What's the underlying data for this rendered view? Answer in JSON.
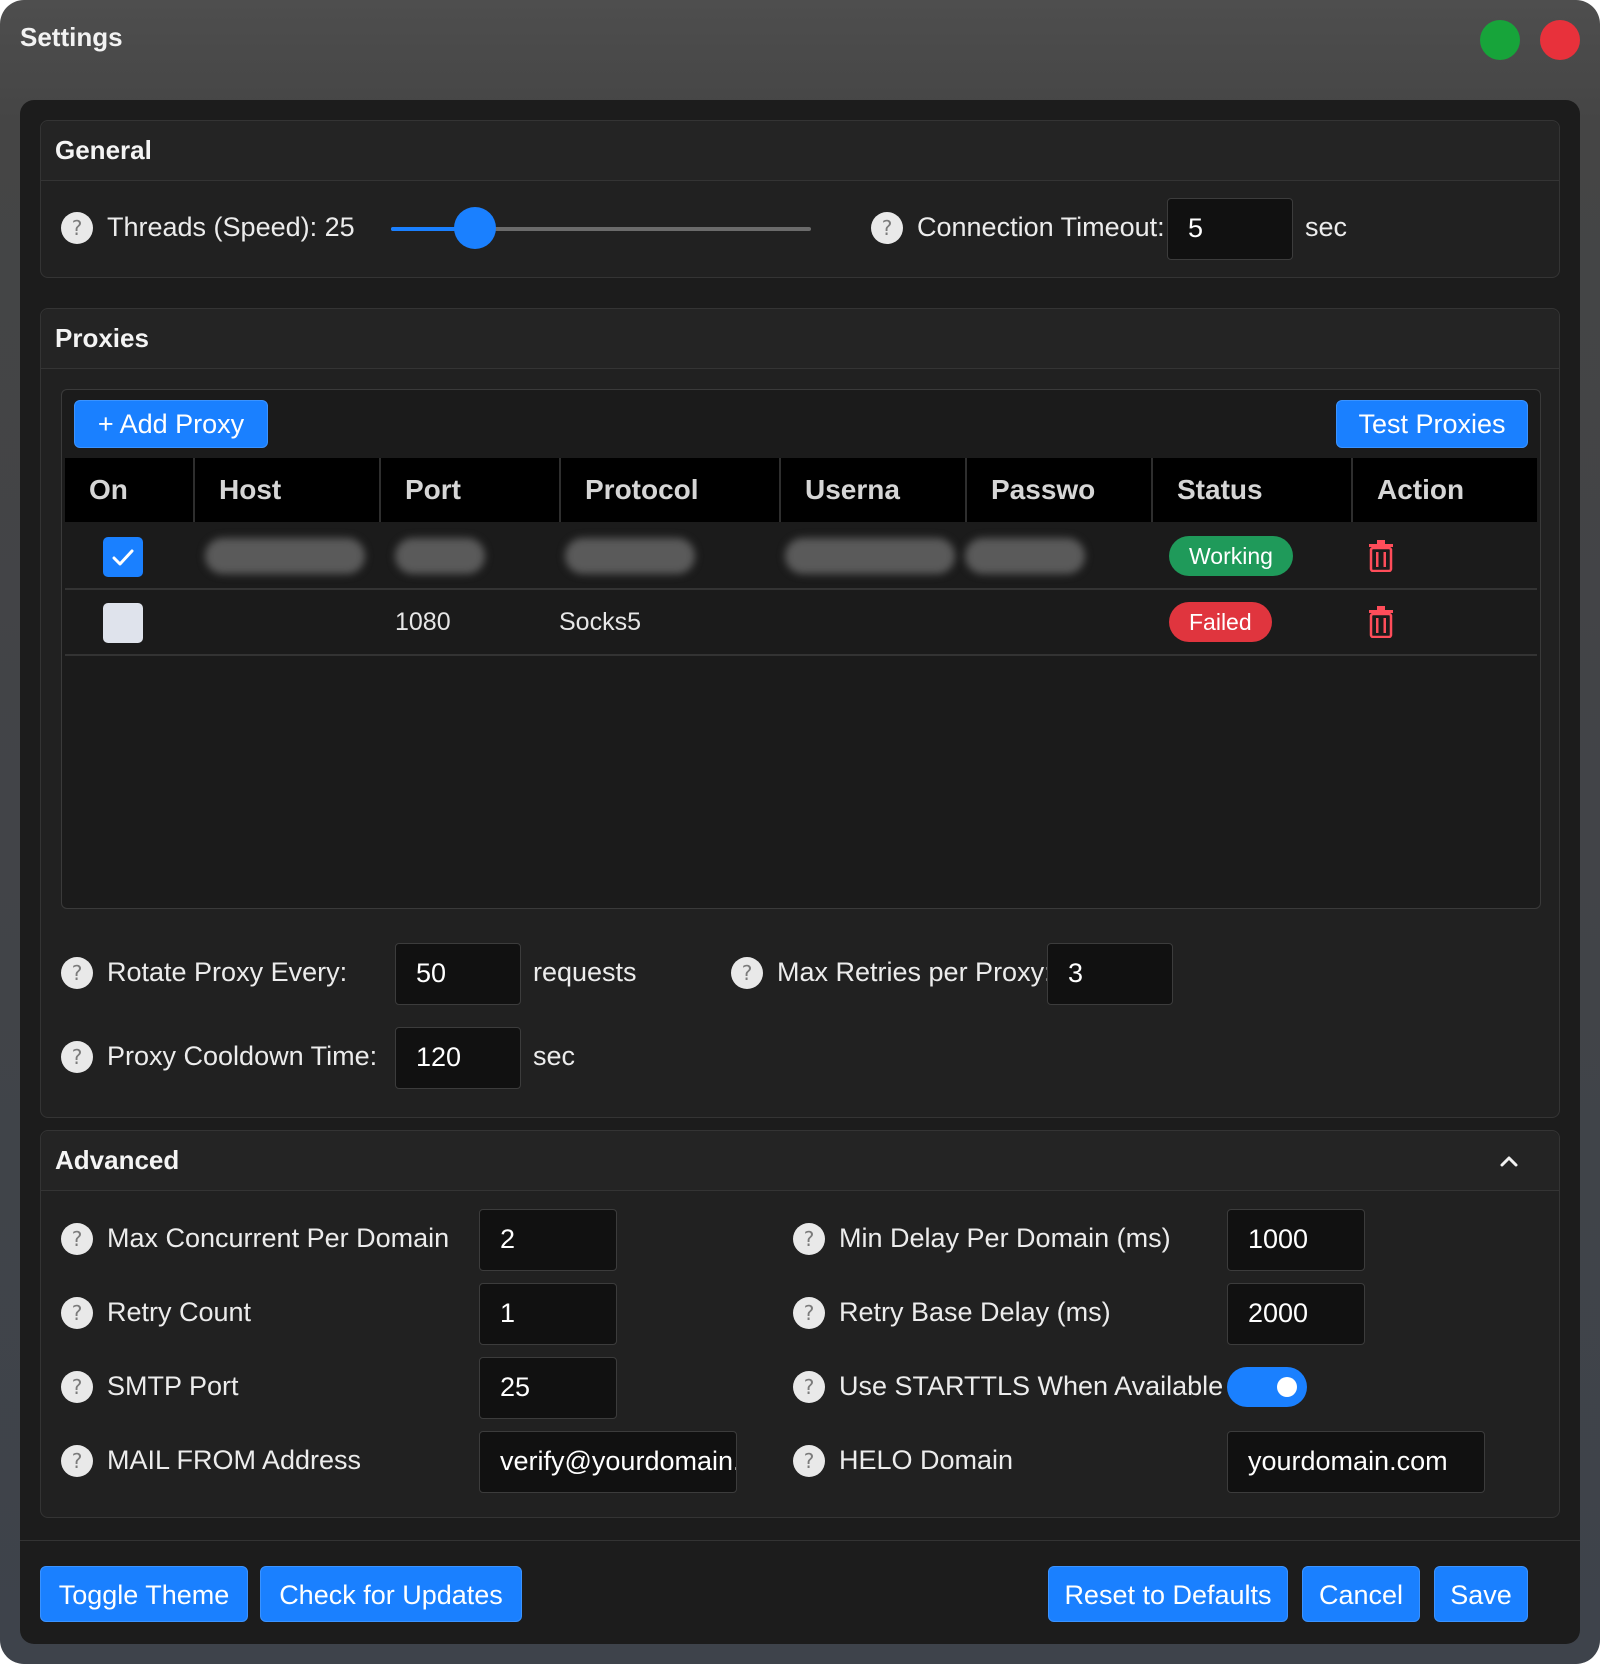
{
  "window": {
    "title": "Settings"
  },
  "general": {
    "title": "General",
    "threads_label": "Threads (Speed): 25",
    "threads_value": 25,
    "threads_fraction": 0.2,
    "timeout_label": "Connection Timeout:",
    "timeout_value": "5",
    "timeout_unit": "sec"
  },
  "proxies": {
    "title": "Proxies",
    "add_button": "+ Add Proxy",
    "test_button": "Test Proxies",
    "columns": [
      "On",
      "Host",
      "Port",
      "Protocol",
      "Userna",
      "Passwo",
      "Status",
      "Action"
    ],
    "rows": [
      {
        "on": true,
        "host": "",
        "port": "",
        "protocol": "",
        "username": "",
        "password": "",
        "status": "Working",
        "redacted": true
      },
      {
        "on": false,
        "host": "",
        "port": "1080",
        "protocol": "Socks5",
        "username": "",
        "password": "",
        "status": "Failed",
        "redacted": false
      }
    ],
    "rotate_label": "Rotate Proxy Every:",
    "rotate_value": "50",
    "rotate_unit": "requests",
    "max_retries_label": "Max Retries per Proxy:",
    "max_retries_value": "3",
    "cooldown_label": "Proxy Cooldown Time:",
    "cooldown_value": "120",
    "cooldown_unit": "sec"
  },
  "advanced": {
    "title": "Advanced",
    "max_concurrent_label": "Max Concurrent Per Domain",
    "max_concurrent_value": "2",
    "min_delay_label": "Min Delay Per Domain (ms)",
    "min_delay_value": "1000",
    "retry_count_label": "Retry Count",
    "retry_count_value": "1",
    "retry_base_label": "Retry Base Delay (ms)",
    "retry_base_value": "2000",
    "smtp_port_label": "SMTP Port",
    "smtp_port_value": "25",
    "starttls_label": "Use STARTTLS When Available",
    "starttls_on": true,
    "mail_from_label": "MAIL FROM Address",
    "mail_from_value": "verify@yourdomain.com",
    "helo_label": "HELO Domain",
    "helo_value": "yourdomain.com"
  },
  "footer": {
    "toggle_theme": "Toggle Theme",
    "check_updates": "Check for Updates",
    "reset_defaults": "Reset to Defaults",
    "cancel": "Cancel",
    "save": "Save"
  },
  "colors": {
    "accent": "#1a80ff",
    "working": "#1f9a5a",
    "failed": "#e0353e",
    "close": "#e8313b",
    "maximize": "#17a43a"
  }
}
